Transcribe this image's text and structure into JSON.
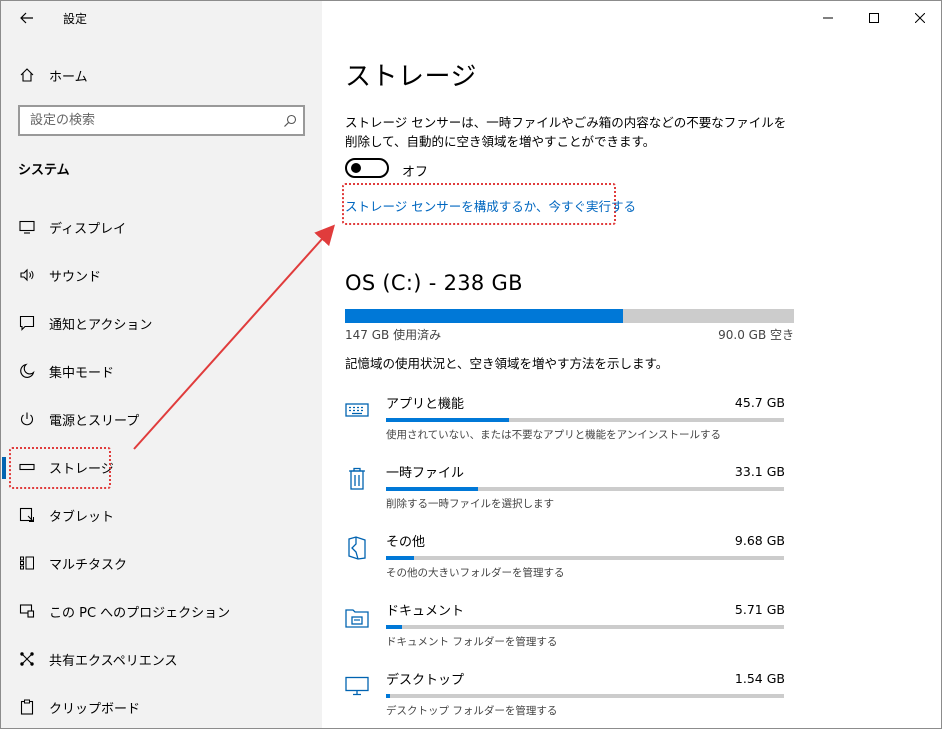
{
  "window": {
    "title": "設定"
  },
  "sidebar": {
    "home_label": "ホーム",
    "search_placeholder": "設定の検索",
    "section": "システム",
    "items": [
      {
        "label": "ディスプレイ",
        "icon": "monitor-icon"
      },
      {
        "label": "サウンド",
        "icon": "speaker-icon"
      },
      {
        "label": "通知とアクション",
        "icon": "notification-icon"
      },
      {
        "label": "集中モード",
        "icon": "moon-icon"
      },
      {
        "label": "電源とスリープ",
        "icon": "power-icon"
      },
      {
        "label": "ストレージ",
        "icon": "storage-icon",
        "active": true
      },
      {
        "label": "タブレット",
        "icon": "tablet-icon"
      },
      {
        "label": "マルチタスク",
        "icon": "multitask-icon"
      },
      {
        "label": "この PC へのプロジェクション",
        "icon": "projection-icon"
      },
      {
        "label": "共有エクスペリエンス",
        "icon": "share-icon"
      },
      {
        "label": "クリップボード",
        "icon": "clipboard-icon"
      }
    ]
  },
  "main": {
    "title": "ストレージ",
    "description": "ストレージ センサーは、一時ファイルやごみ箱の内容などの不要なファイルを削除して、自動的に空き領域を増やすことができます。",
    "toggle": {
      "state": "off",
      "label": "オフ"
    },
    "sensor_link": "ストレージ センサーを構成するか、今すぐ実行する",
    "drive": {
      "title": "OS (C:) - 238 GB",
      "used_label": "147 GB 使用済み",
      "free_label": "90.0 GB 空き",
      "used_fraction": 0.62,
      "description": "記憶域の使用状況と、空き領域を増やす方法を示します。"
    },
    "categories": [
      {
        "name": "アプリと機能",
        "size": "45.7 GB",
        "fraction": 0.31,
        "hint": "使用されていない、または不要なアプリと機能をアンインストールする",
        "icon": "keyboard-icon"
      },
      {
        "name": "一時ファイル",
        "size": "33.1 GB",
        "fraction": 0.23,
        "hint": "削除する一時ファイルを選択します",
        "icon": "trash-icon"
      },
      {
        "name": "その他",
        "size": "9.68 GB",
        "fraction": 0.07,
        "hint": "その他の大きいフォルダーを管理する",
        "icon": "other-icon"
      },
      {
        "name": "ドキュメント",
        "size": "5.71 GB",
        "fraction": 0.04,
        "hint": "ドキュメント フォルダーを管理する",
        "icon": "documents-icon"
      },
      {
        "name": "デスクトップ",
        "size": "1.54 GB",
        "fraction": 0.01,
        "hint": "デスクトップ フォルダーを管理する",
        "icon": "desktop-icon"
      }
    ]
  },
  "colors": {
    "accent": "#0078d7",
    "link": "#0067c0",
    "annotation": "#e03c3c"
  }
}
